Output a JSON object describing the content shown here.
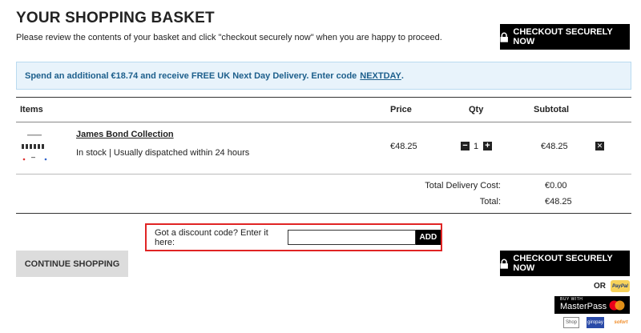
{
  "header": {
    "title": "YOUR SHOPPING BASKET",
    "subtitle": "Please review the contents of your basket and click \"checkout securely now\" when you are happy to proceed."
  },
  "checkout": {
    "label": "CHECKOUT SECURELY NOW"
  },
  "promo": {
    "text": "Spend an additional €18.74 and receive FREE UK Next Day Delivery. Enter code",
    "code": "NEXTDAY",
    "suffix": "."
  },
  "table": {
    "headers": {
      "items": "Items",
      "price": "Price",
      "qty": "Qty",
      "subtotal": "Subtotal"
    },
    "rows": [
      {
        "name": "James Bond Collection",
        "stock": "In stock | Usually dispatched within 24 hours",
        "price": "€48.25",
        "qty": "1",
        "subtotal": "€48.25"
      }
    ]
  },
  "totals": {
    "delivery_label": "Total Delivery Cost:",
    "delivery_value": "€0.00",
    "total_label": "Total:",
    "total_value": "€48.25"
  },
  "discount": {
    "label": "Got a discount code? Enter it here:",
    "value": "",
    "add_label": "ADD"
  },
  "continue": {
    "label": "CONTINUE SHOPPING"
  },
  "payment": {
    "or": "OR",
    "paypal": "PayPal",
    "masterpass_small": "BUY WITH",
    "masterpass": "MasterPass",
    "badges": [
      "Shop",
      "giropay",
      "sofort"
    ]
  },
  "colors": {
    "accent": "#000000",
    "promo_bg": "#e8f3fb",
    "promo_text": "#1d5f8c",
    "highlight": "#e02424"
  }
}
